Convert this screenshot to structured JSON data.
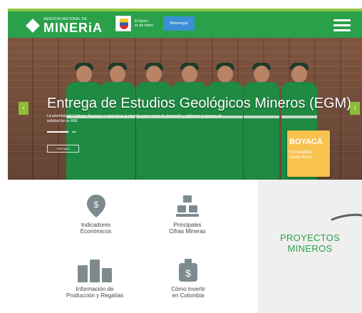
{
  "header": {
    "logo_small": "AGENCIA NACIONAL DE",
    "logo_big": "MINERiA",
    "gov_line_1": "El futuro",
    "gov_line_2": "es de todos",
    "ministry_label": "Minenergía",
    "colors": {
      "header_green": "#2aa04a",
      "accent_green": "#8fc741",
      "ministry_blue": "#3b8fd6"
    },
    "menu_icon": "hamburger-menu-icon"
  },
  "hero": {
    "title": "Entrega de Estudios Geológicos Mineros (EGM)",
    "description": "La prioridad del Gobierno Nacional es formalizar la minería como motor de desarrollo y optimizar el proceso de solicitud de un ARE",
    "button_label": "VER MÁS",
    "poster_title": "BOYACÁ",
    "poster_sub_1": "Esmeraldas",
    "poster_sub_2": "Santa Rosa",
    "prev_icon": "chevron-left-icon",
    "next_icon": "chevron-right-icon",
    "prev_label": "‹",
    "next_label": "›"
  },
  "tiles": [
    {
      "label_1": "Indicadores",
      "label_2": "Económicos",
      "icon": "dollar-pin-icon"
    },
    {
      "label_1": "Principales",
      "label_2": "Cifras Mineras",
      "icon": "gold-bars-icon"
    },
    {
      "label_1": "Información de",
      "label_2": "Producción y Regalías",
      "icon": "bar-chart-icon"
    },
    {
      "label_1": "Cómo invertir",
      "label_2": "en Colombia",
      "icon": "money-bag-icon"
    }
  ],
  "projects": {
    "title_1": "PROYECTOS",
    "title_2": "MINEROS"
  }
}
